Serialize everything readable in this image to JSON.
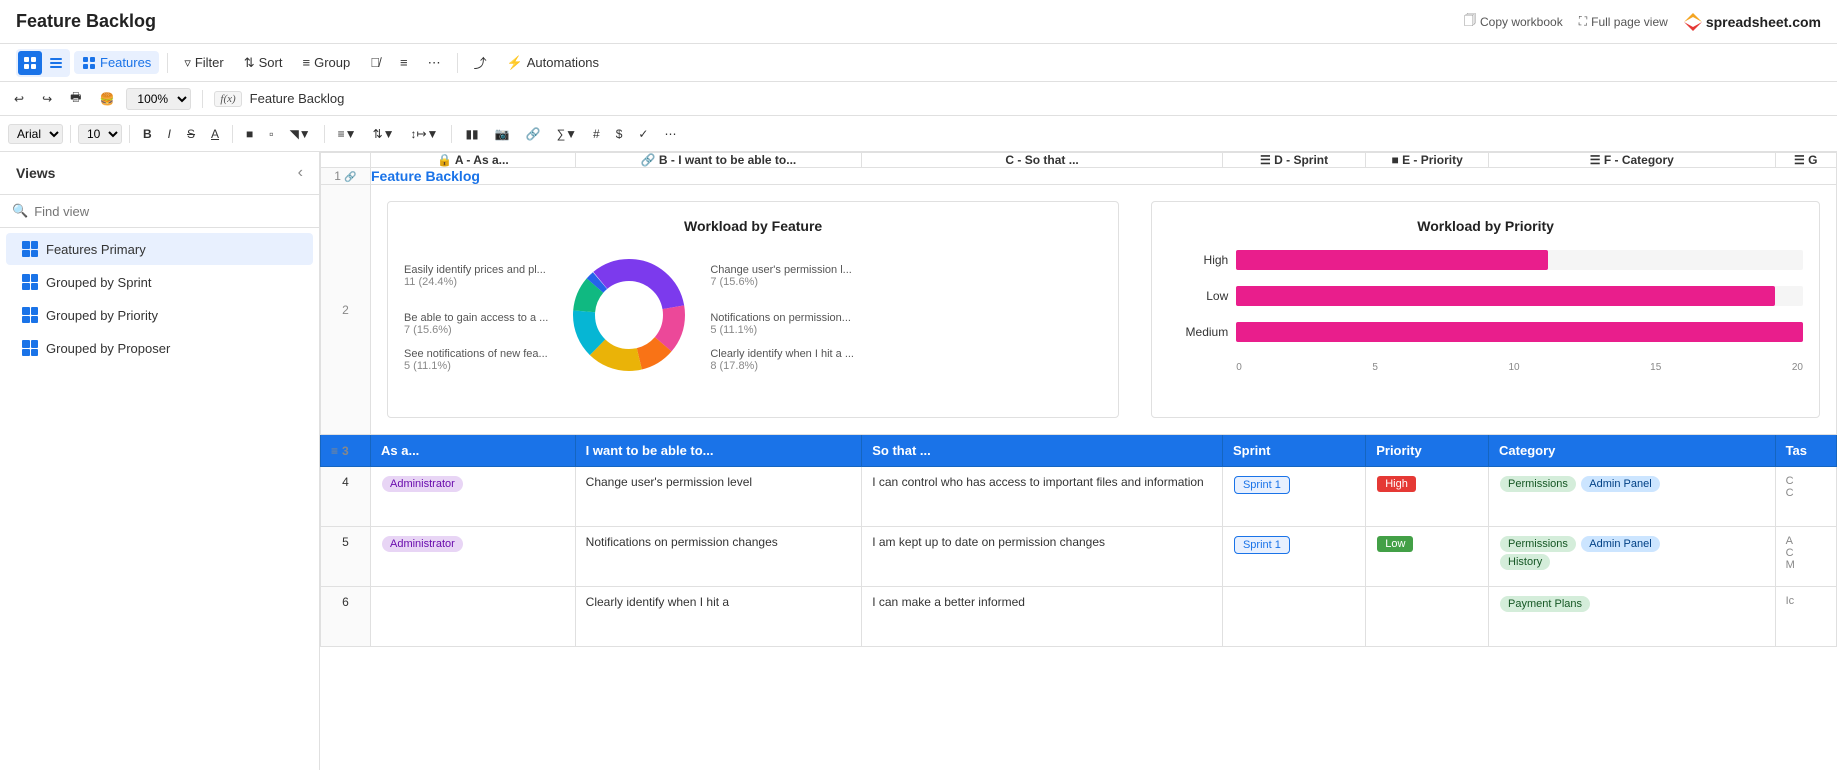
{
  "app": {
    "title": "Feature Backlog",
    "brand": "spreadsheet.com"
  },
  "topbar": {
    "copy_workbook": "Copy workbook",
    "full_page_view": "Full page view"
  },
  "toolbar": {
    "features_label": "Features",
    "filter_label": "Filter",
    "sort_label": "Sort",
    "group_label": "Group",
    "automations_label": "Automations"
  },
  "formula_bar": {
    "value": "Feature Backlog"
  },
  "sidebar": {
    "title": "Views",
    "search_placeholder": "Find view",
    "items": [
      {
        "label": "Features  Primary",
        "active": true
      },
      {
        "label": "Grouped by Sprint",
        "active": false
      },
      {
        "label": "Grouped by Priority",
        "active": false
      },
      {
        "label": "Grouped by Proposer",
        "active": false
      }
    ]
  },
  "columns": {
    "row_num": "#",
    "a": "A - As a...",
    "b": "B - I want to be able to...",
    "c": "C - So that ...",
    "d": "D - Sprint",
    "e": "E - Priority",
    "f": "F - Category",
    "g": "G"
  },
  "header_row": {
    "col_a": "As a...",
    "col_b": "I want to be able to...",
    "col_c": "So that ...",
    "col_d": "Sprint",
    "col_e": "Priority",
    "col_f": "Category",
    "col_g": "Tas"
  },
  "chart1": {
    "title": "Workload by Feature",
    "segments": [
      {
        "label": "Easily identify prices and pl...",
        "value": "11 (24.4%)",
        "color": "#7c3aed"
      },
      {
        "label": "Change user's permission l...",
        "value": "7 (15.6%)",
        "color": "#ec4899"
      },
      {
        "label": "Notifications on permission...",
        "value": "5 (11.1%)",
        "color": "#f97316"
      },
      {
        "label": "Clearly identify when I hit a ...",
        "value": "8 (17.8%)",
        "color": "#eab308"
      },
      {
        "label": "Be able to gain access to a ...",
        "value": "7 (15.6%)",
        "color": "#06b6d4"
      },
      {
        "label": "See notifications of new fea...",
        "value": "5 (11.1%)",
        "color": "#10b981"
      }
    ]
  },
  "chart2": {
    "title": "Workload by Priority",
    "bars": [
      {
        "label": "High",
        "value": 11,
        "max": 20,
        "pct": 55
      },
      {
        "label": "Low",
        "value": 19,
        "max": 20,
        "pct": 95
      },
      {
        "label": "Medium",
        "value": 20,
        "max": 20,
        "pct": 100
      }
    ],
    "axis_labels": [
      "0",
      "5",
      "10",
      "15",
      "20"
    ]
  },
  "rows": [
    {
      "row_num": "4",
      "col_a_tag": "Administrator",
      "col_b": "Change user's permission level",
      "col_c": "I can control who has access to important files and information",
      "col_d_tag": "Sprint 1",
      "col_e_tag": "High",
      "col_e_type": "high",
      "col_f_tags": [
        "Permissions",
        "Admin Panel"
      ],
      "col_g1": "C",
      "col_g2": "C"
    },
    {
      "row_num": "5",
      "col_a_tag": "Administrator",
      "col_b": "Notifications on permission changes",
      "col_c": "I am kept up to date on permission changes",
      "col_d_tag": "Sprint 1",
      "col_e_tag": "Low",
      "col_e_type": "low",
      "col_f_tags": [
        "Permissions",
        "Admin Panel"
      ],
      "col_f_extra": "History",
      "col_g1": "A",
      "col_g2": "C"
    },
    {
      "row_num": "6",
      "col_a_tag": "",
      "col_b": "Clearly identify when I hit a",
      "col_c": "I can make a better informed",
      "col_d_tag": "",
      "col_e_tag": "",
      "col_e_type": "",
      "col_f_tags": [
        "Payment Plans"
      ],
      "col_g1": "Ic",
      "col_g2": ""
    }
  ],
  "zoom": "100%"
}
